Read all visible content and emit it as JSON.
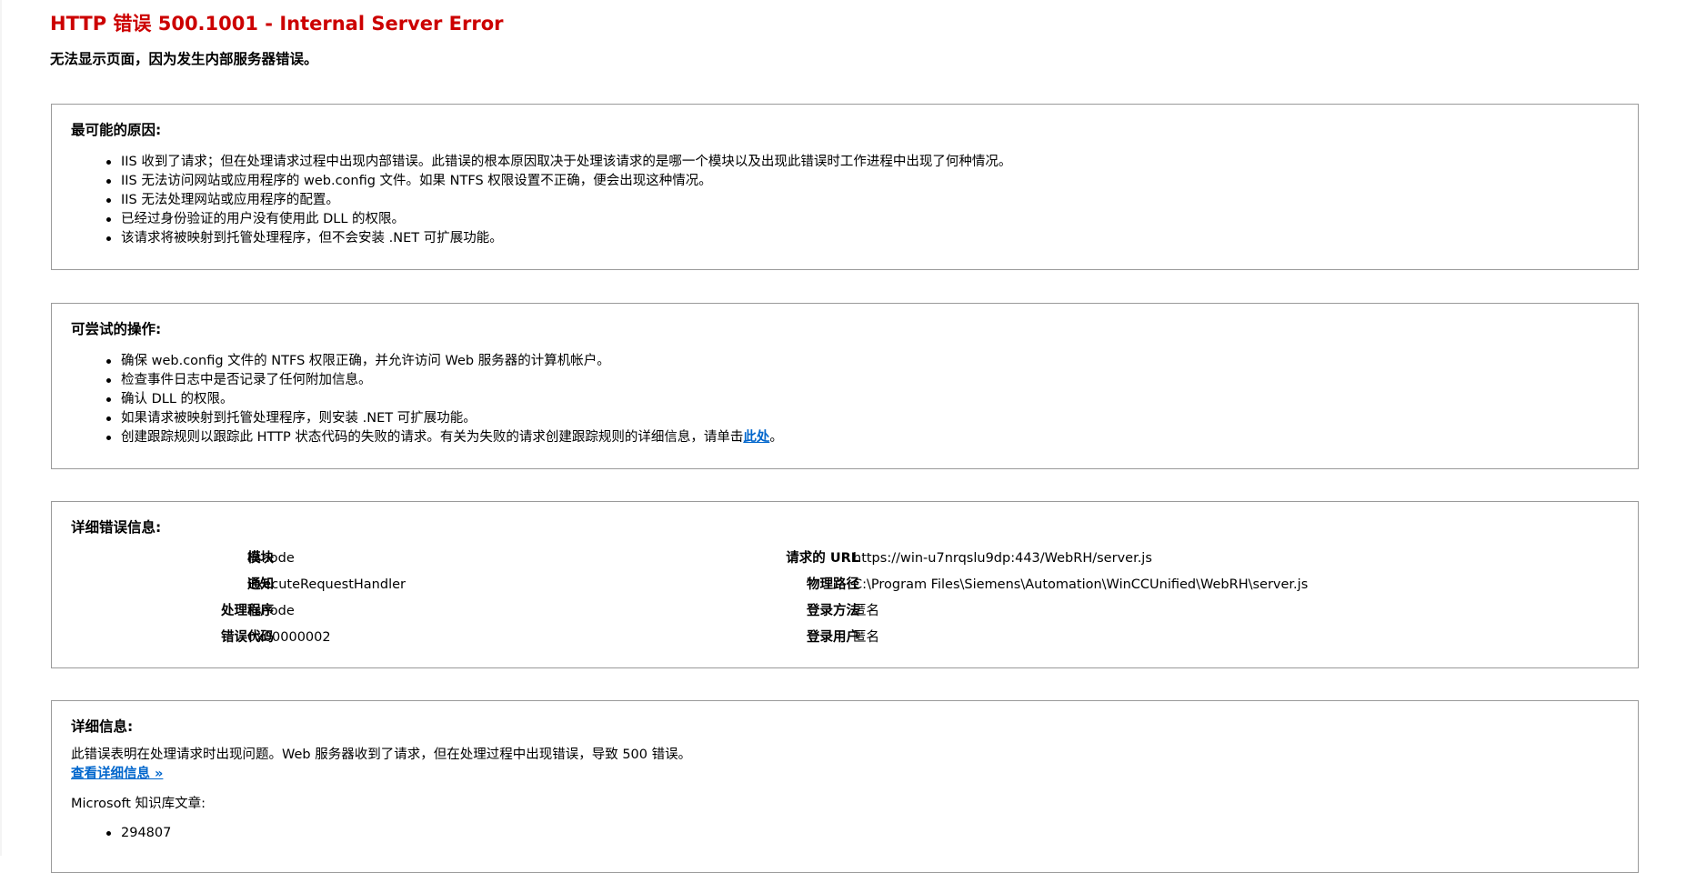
{
  "page": {
    "title": "HTTP 错误 500.1001 - Internal Server Error",
    "subtitle": "无法显示页面，因为发生内部服务器错误。",
    "title_color": "#cc0000",
    "link_color": "#0066cc"
  },
  "causes": {
    "heading": "最可能的原因:",
    "items": [
      "IIS 收到了请求；但在处理请求过程中出现内部错误。此错误的根本原因取决于处理该请求的是哪一个模块以及出现此错误时工作进程中出现了何种情况。",
      "IIS 无法访问网站或应用程序的 web.config 文件。如果 NTFS 权限设置不正确，便会出现这种情况。",
      "IIS 无法处理网站或应用程序的配置。",
      "已经过身份验证的用户没有使用此 DLL 的权限。",
      "该请求将被映射到托管处理程序，但不会安装 .NET 可扩展功能。"
    ]
  },
  "actions": {
    "heading": "可尝试的操作:",
    "items": [
      "确保 web.config 文件的 NTFS 权限正确，并允许访问 Web 服务器的计算机帐户。",
      "检查事件日志中是否记录了任何附加信息。",
      "确认 DLL 的权限。",
      "如果请求被映射到托管处理程序，则安装 .NET 可扩展功能。"
    ],
    "last_item_prefix": "创建跟踪规则以跟踪此 HTTP 状态代码的失败的请求。有关为失败的请求创建跟踪规则的详细信息，请单击",
    "last_item_link": "此处",
    "last_item_suffix": "。"
  },
  "details": {
    "heading": "详细错误信息:",
    "left": [
      {
        "label": "模块",
        "value": "iisnode"
      },
      {
        "label": "通知",
        "value": "ExecuteRequestHandler"
      },
      {
        "label": "处理程序",
        "value": "iisnode"
      },
      {
        "label": "错误代码",
        "value": "0x00000002"
      }
    ],
    "right": [
      {
        "label": "请求的 URL",
        "value": "https://win-u7nrqslu9dp:443/WebRH/server.js"
      },
      {
        "label": "物理路径",
        "value": "C:\\Program Files\\Siemens\\Automation\\WinCCUnified\\WebRH\\server.js"
      },
      {
        "label": "登录方法",
        "value": "匿名"
      },
      {
        "label": "登录用户",
        "value": "匿名"
      }
    ]
  },
  "info": {
    "heading": "详细信息:",
    "text": "此错误表明在处理请求时出现问题。Web 服务器收到了请求，但在处理过程中出现错误，导致 500 错误。",
    "link": "查看详细信息 »",
    "kb_title": "Microsoft 知识库文章:",
    "kb_items": [
      "294807"
    ]
  }
}
